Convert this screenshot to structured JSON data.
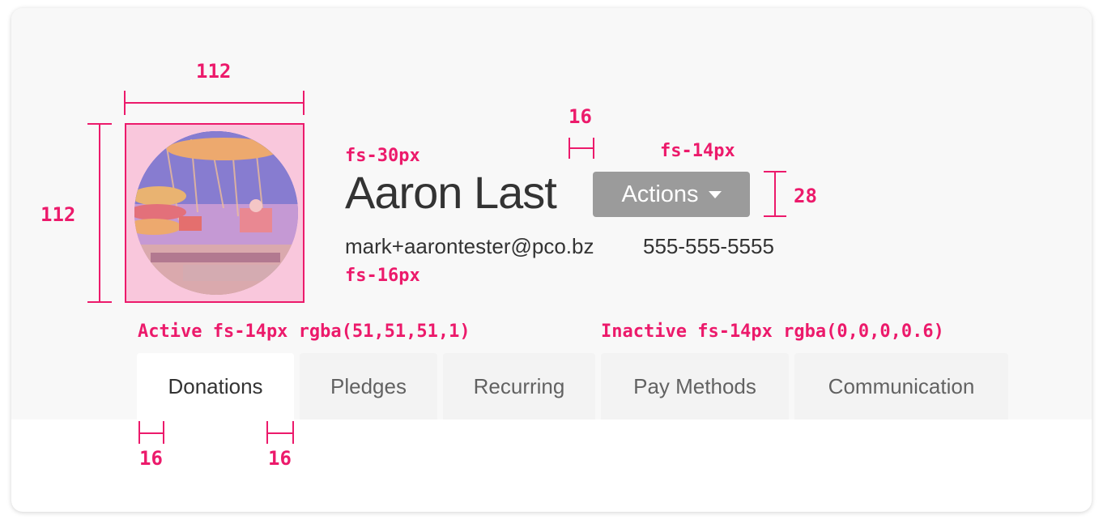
{
  "profile": {
    "name": "Aaron Last",
    "email": "mark+aarontester@pco.bz",
    "phone": "555-555-5555",
    "avatar_alt": "avatar-photo"
  },
  "actions": {
    "label": "Actions"
  },
  "tabs": [
    {
      "label": "Donations",
      "active": true
    },
    {
      "label": "Pledges",
      "active": false
    },
    {
      "label": "Recurring",
      "active": false
    },
    {
      "label": "Pay Methods",
      "active": false
    },
    {
      "label": "Communication",
      "active": false
    }
  ],
  "annotations": {
    "avatar_width": "112",
    "avatar_height": "112",
    "name_font": "fs-30px",
    "gap_name_actions": "16",
    "actions_font": "fs-14px",
    "actions_height": "28",
    "contact_font": "fs-16px",
    "active_tab": "Active fs-14px rgba(51,51,51,1)",
    "inactive_tab": "Inactive fs-14px rgba(0,0,0,0.6)",
    "tab_padding_left": "16",
    "tab_padding_right": "16"
  },
  "colors": {
    "annotation": "#ec1a6b",
    "actions_button": "#9b9b9b",
    "header_bg": "#f8f8f8",
    "text_primary": "#333333"
  }
}
